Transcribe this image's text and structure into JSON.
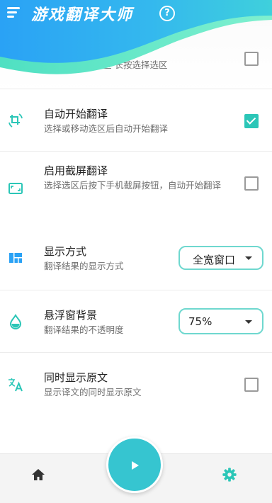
{
  "app": {
    "title": "游戏翻译大师",
    "accent_color": "#2bc6b7",
    "header_gradient": [
      "#2aa2f5",
      "#3cc6e6",
      "#49e0c4"
    ]
  },
  "header": {
    "menu_icon": "hamburger-icon",
    "help_icon_glyph": "?"
  },
  "settings": {
    "select_region": {
      "subtitle": "择选区 长按选择选区",
      "checked": false
    },
    "auto_translate": {
      "title": "自动开始翻译",
      "subtitle": "选择或移动选区后自动开始翻译",
      "checked": true,
      "icon": "auto-rotate-icon"
    },
    "screenshot_translate": {
      "title": "启用截屏翻译",
      "subtitle": "选择选区后按下手机截屏按钮，自动开始翻译",
      "checked": false,
      "icon": "screenshot-icon"
    },
    "display_mode": {
      "title": "显示方式",
      "subtitle": "翻译结果的显示方式",
      "value": "全宽窗口",
      "icon": "layout-icon"
    },
    "float_background": {
      "title": "悬浮窗背景",
      "subtitle": "翻译结果的不透明度",
      "value": "75%",
      "icon": "opacity-drop-icon"
    },
    "show_original": {
      "title": "同时显示原文",
      "subtitle": "显示译文的同时显示原文",
      "checked": false,
      "icon": "translate-icon"
    }
  },
  "bottom_nav": {
    "home_icon": "home-icon",
    "play_icon": "play-icon",
    "settings_icon": "gear-icon"
  }
}
